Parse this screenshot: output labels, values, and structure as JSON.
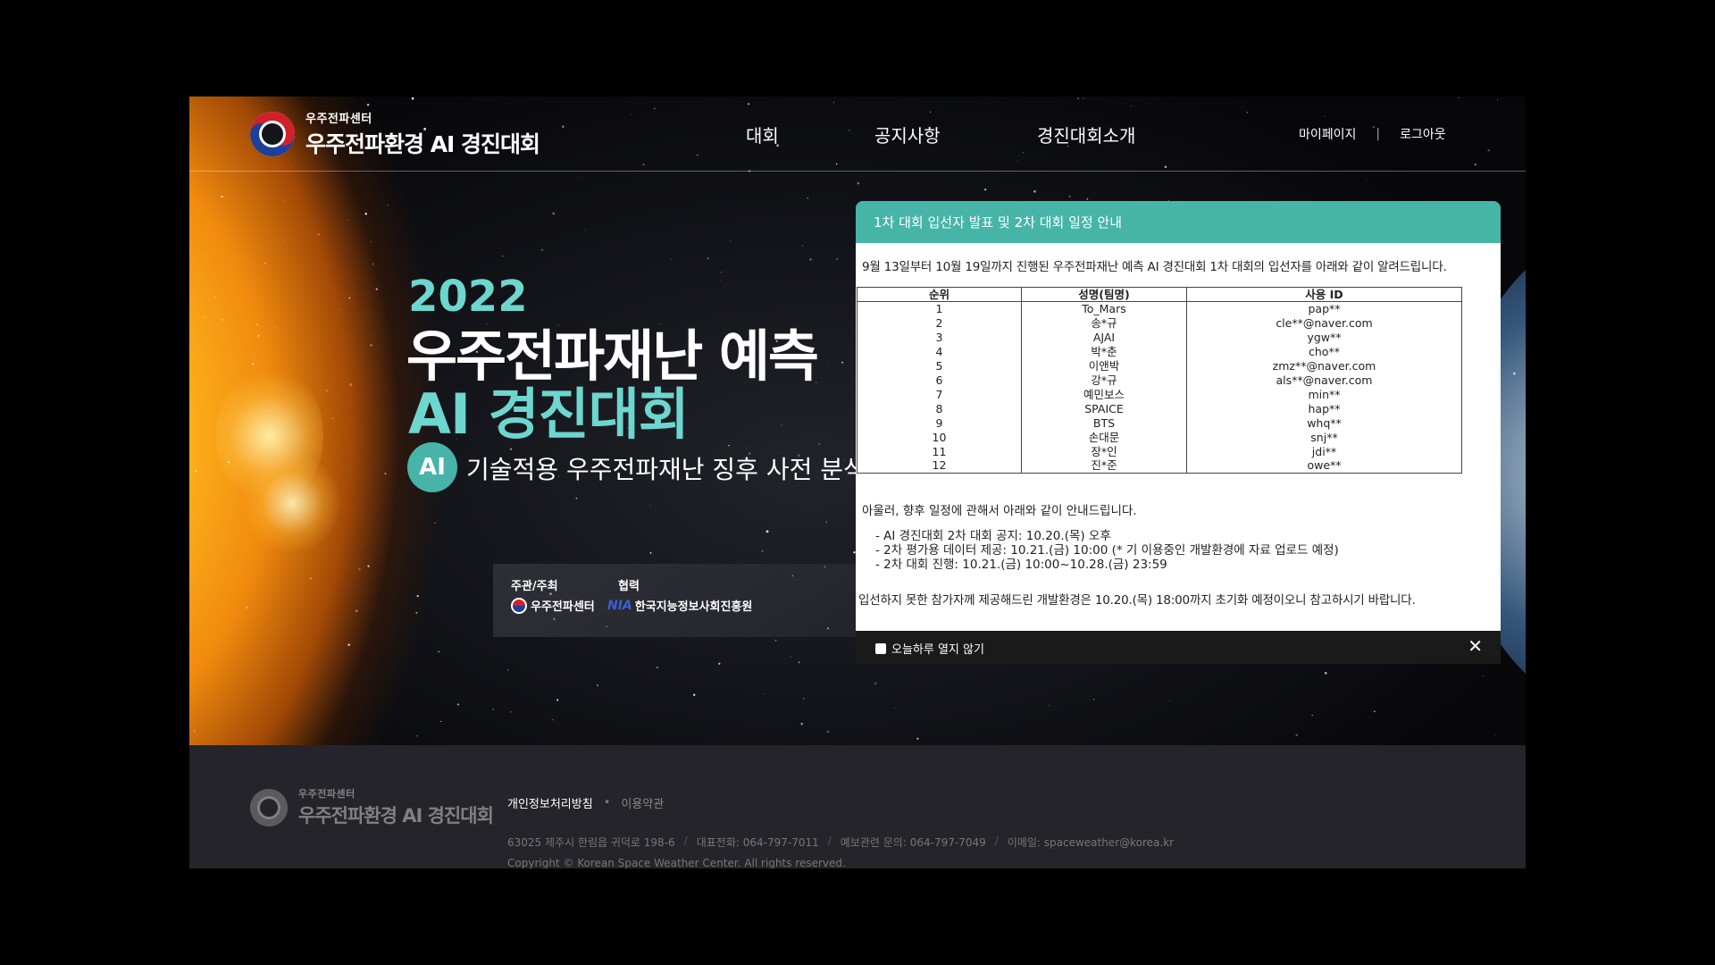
{
  "header": {
    "logo_small": "우주전파센터",
    "logo_big": "우주전파환경 AI 경진대회",
    "nav": [
      "대회",
      "공지사항",
      "경진대회소개"
    ],
    "mypage": "마이페이지",
    "separator": "|",
    "logout": "로그아웃"
  },
  "hero": {
    "year": "2022",
    "title": "우주전파재난 예측",
    "subtitle": "AI 경진대회",
    "badge": "AI",
    "tagline": "기술적용 우주전파재난 징후 사전 분석 (",
    "host_label": "주관/주최",
    "host_name": "우주전파센터",
    "partner_label": "협력",
    "partner_logo": "NIA",
    "partner_name": "한국지능정보사회진흥원"
  },
  "popup": {
    "title": "1차 대회 입선자 발표 및 2차 대회 일정 안내",
    "intro": "9월 13일부터 10월 19일까지 진행된 우주전파재난 예측 AI 경진대회 1차 대회의 입선자를 아래와 같이 알려드립니다.",
    "table": {
      "headers": [
        "순위",
        "성명(팀명)",
        "사용 ID"
      ],
      "rows": [
        [
          "1",
          "To_Mars",
          "pap**"
        ],
        [
          "2",
          "송*규",
          "cle**@naver.com"
        ],
        [
          "3",
          "AJAI",
          "ygw**"
        ],
        [
          "4",
          "박*춘",
          "cho**"
        ],
        [
          "5",
          "이앤박",
          "zmz**@naver.com"
        ],
        [
          "6",
          "강*규",
          "als**@naver.com"
        ],
        [
          "7",
          "예민보스",
          "min**"
        ],
        [
          "8",
          "SPAICE",
          "hap**"
        ],
        [
          "9",
          "BTS",
          "whq**"
        ],
        [
          "10",
          "손대문",
          "snj**"
        ],
        [
          "11",
          "장*인",
          "jdi**"
        ],
        [
          "12",
          "진*준",
          "owe**"
        ]
      ]
    },
    "follow": "아울러, 향후 일정에 관해서 아래와 같이 안내드립니다.",
    "schedule": [
      "-  AI 경진대회 2차 대회 공지: 10.20.(목) 오후",
      "- 2차 평가용 데이터 제공: 10.21.(금) 10:00 (* 기 이용중인 개발환경에 자료 업로드 예정)",
      "- 2차 대회 진행: 10.21.(금) 10:00~10.28.(금) 23:59"
    ],
    "note": "입선하지 못한 참가자께 제공해드린 개발환경은 10.20.(목) 18:00까지 초기화 예정이오니 참고하시기 바랍니다.",
    "dismiss_label": "오늘하루 열지 않기",
    "close_icon": "✕",
    "accent_color": "#46b5a8"
  },
  "footer": {
    "logo_small": "우주전파센터",
    "logo_big": "우주전파환경 AI 경진대회",
    "privacy": "개인정보처리방침",
    "dot": "•",
    "terms": "이용약관",
    "address": "63025 제주시 한림읍 귀덕로 198-6",
    "phone": "대표전화: 064-797-7011",
    "forecast": "예보관련 문의: 064-797-7049",
    "email": "이메일: spaceweather@korea.kr",
    "slash": "/",
    "copyright": "Copyright © Korean Space Weather Center. All rights reserved."
  }
}
